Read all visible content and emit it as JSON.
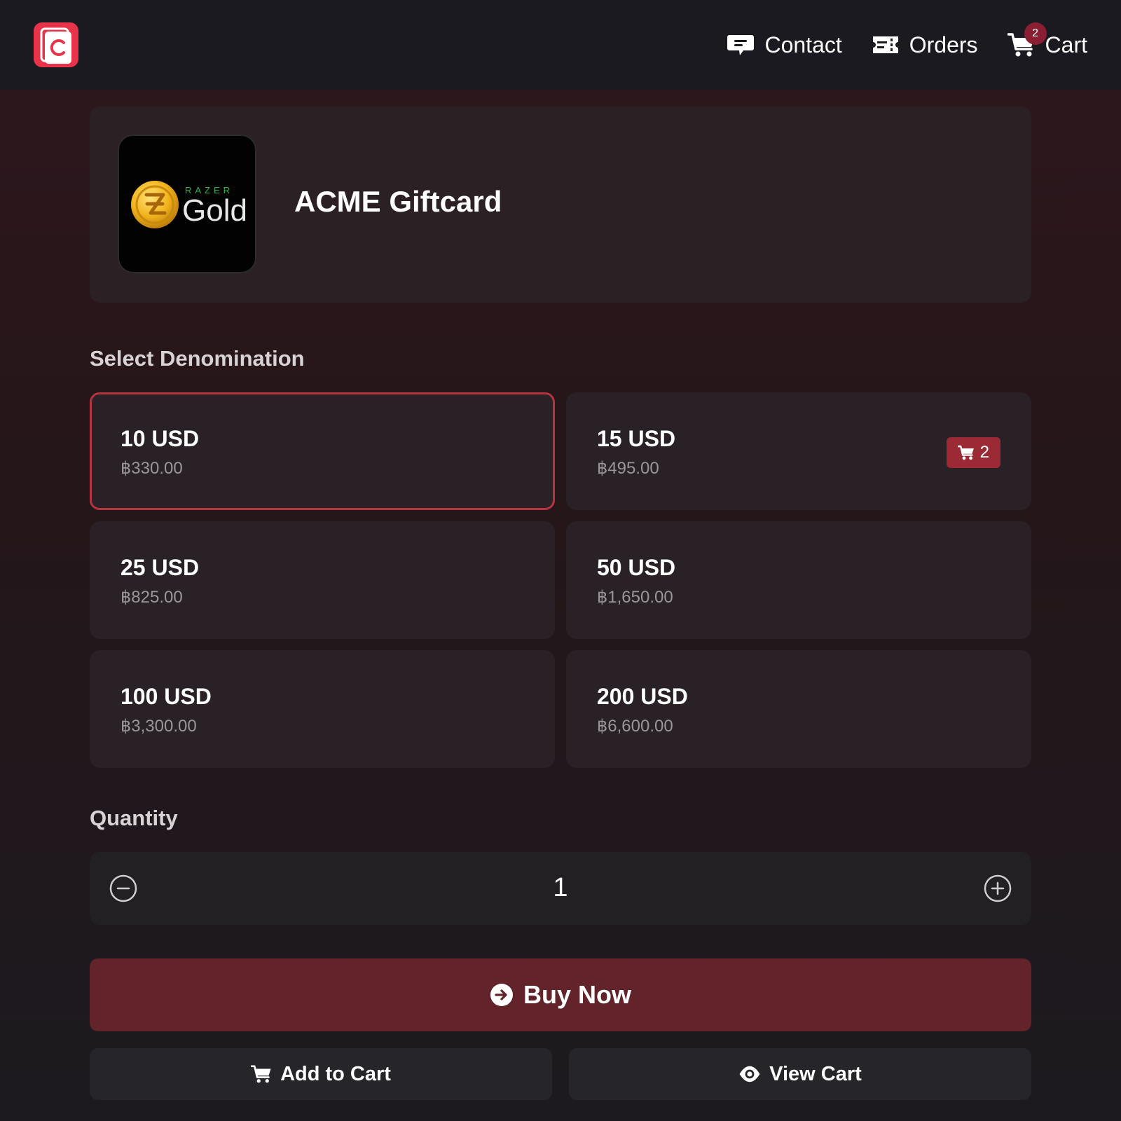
{
  "header": {
    "nav": {
      "contact": "Contact",
      "orders": "Orders",
      "cart": "Cart",
      "cart_count": "2"
    }
  },
  "product": {
    "title": "ACME Giftcard",
    "image": {
      "brand_top": "RAZER",
      "brand_main": "Gold"
    }
  },
  "denomination": {
    "title": "Select Denomination",
    "selected_index": 0,
    "options": [
      {
        "amount": "10 USD",
        "price": "฿330.00"
      },
      {
        "amount": "15 USD",
        "price": "฿495.00",
        "in_cart": "2"
      },
      {
        "amount": "25 USD",
        "price": "฿825.00"
      },
      {
        "amount": "50 USD",
        "price": "฿1,650.00"
      },
      {
        "amount": "100 USD",
        "price": "฿3,300.00"
      },
      {
        "amount": "200 USD",
        "price": "฿6,600.00"
      }
    ]
  },
  "quantity": {
    "title": "Quantity",
    "value": "1"
  },
  "actions": {
    "buy_now": "Buy Now",
    "add_to_cart": "Add to Cart",
    "view_cart": "View Cart"
  },
  "colors": {
    "accent": "#e8344a",
    "selected_border": "#b3333f",
    "buy_button": "#63232a",
    "badge": "#9b2a35"
  }
}
